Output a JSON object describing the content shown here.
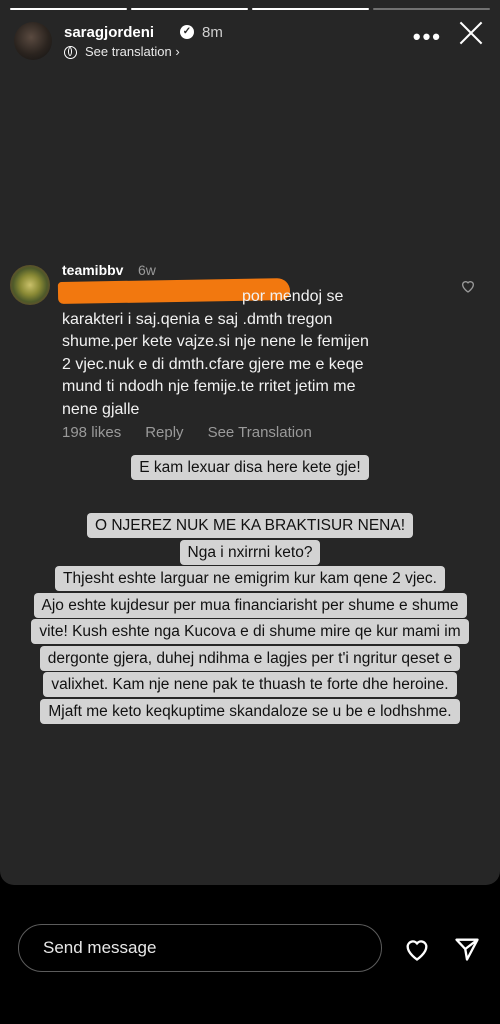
{
  "header": {
    "username": "saragjordeni",
    "time": "8m",
    "see_translation": "See translation",
    "more": "•••"
  },
  "comment": {
    "username": "teamibbv",
    "age": "6w",
    "line1": "por mendoj se",
    "line2": "karakteri i saj.qenia e saj .dmth tregon",
    "line3": "shume.per kete vajze.si nje nene le femijen",
    "line4": "2 vjec.nuk e di dmth.cfare gjere me e keqe",
    "line5": "mund ti ndodh nje femije.te rritet jetim me",
    "line6": "nene gjalle",
    "likes": "198 likes",
    "reply": "Reply",
    "see_translation": "See Translation"
  },
  "reply_note": "E kam lexuar disa here kete gje!",
  "response": {
    "lines": [
      "O NJEREZ NUK ME KA BRAKTISUR NENA!",
      "Nga i nxirrni keto?",
      "Thjesht eshte larguar ne emigrim kur kam qene 2 vjec.",
      "Ajo eshte kujdesur per mua financiarisht per shume e shume",
      "vite! Kush eshte nga Kucova e di shume mire qe kur mami im",
      "dergonte gjera, duhej ndihma e lagjes per t'i ngritur qeset e",
      "valixhet. Kam nje nene pak te thuash te forte dhe heroine.",
      "Mjaft me keto keqkuptime skandaloze se u be e lodhshme."
    ]
  },
  "footer": {
    "message_placeholder": "Send message"
  },
  "colors": {
    "story_bg": "#262626",
    "redaction": "#f2780f",
    "sticker_bg": "#d3d3d3"
  }
}
